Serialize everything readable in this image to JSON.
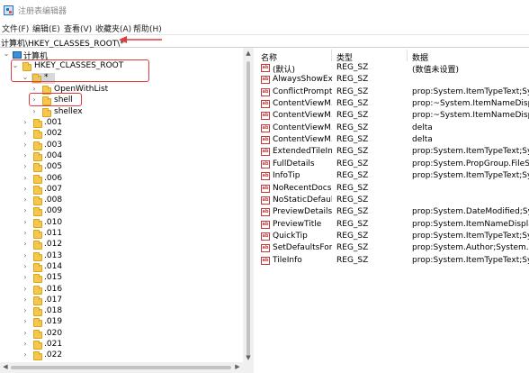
{
  "window": {
    "title": "注册表编辑器"
  },
  "menu": [
    "文件(F)",
    "编辑(E)",
    "查看(V)",
    "收藏夹(A)",
    "帮助(H)"
  ],
  "address": "计算机\\HKEY_CLASSES_ROOT\\*",
  "tree": {
    "root": "计算机",
    "hive": "HKEY_CLASSES_ROOT",
    "selected": "*",
    "children": [
      "OpenWithList",
      "shell",
      "shellex"
    ],
    "siblings": [
      ".001",
      ".002",
      ".003",
      ".004",
      ".005",
      ".006",
      ".007",
      ".008",
      ".009",
      ".010",
      ".011",
      ".012",
      ".013",
      ".014",
      ".015",
      ".016",
      ".017",
      ".018",
      ".019",
      ".020",
      ".021",
      ".022"
    ]
  },
  "values": {
    "columns": [
      "名称",
      "类型",
      "数据"
    ],
    "rows": [
      {
        "name": "(默认)",
        "type": "REG_SZ",
        "data": "(数值未设置)"
      },
      {
        "name": "AlwaysShowExt",
        "type": "REG_SZ",
        "data": ""
      },
      {
        "name": "ConflictPrompt",
        "type": "REG_SZ",
        "data": "prop:System.ItemTypeText;Syste"
      },
      {
        "name": "ContentViewM...",
        "type": "REG_SZ",
        "data": "prop:~System.ItemNameDisplay"
      },
      {
        "name": "ContentViewM...",
        "type": "REG_SZ",
        "data": "prop:~System.ItemNameDisplay"
      },
      {
        "name": "ContentViewM...",
        "type": "REG_SZ",
        "data": "delta"
      },
      {
        "name": "ContentViewM...",
        "type": "REG_SZ",
        "data": "delta"
      },
      {
        "name": "ExtendedTileIn...",
        "type": "REG_SZ",
        "data": "prop:System.ItemTypeText;Syste"
      },
      {
        "name": "FullDetails",
        "type": "REG_SZ",
        "data": "prop:System.PropGroup.FileSyst"
      },
      {
        "name": "InfoTip",
        "type": "REG_SZ",
        "data": "prop:System.ItemTypeText;Syste"
      },
      {
        "name": "NoRecentDocs",
        "type": "REG_SZ",
        "data": ""
      },
      {
        "name": "NoStaticDefaul...",
        "type": "REG_SZ",
        "data": ""
      },
      {
        "name": "PreviewDetails",
        "type": "REG_SZ",
        "data": "prop:System.DateModified;Syste"
      },
      {
        "name": "PreviewTitle",
        "type": "REG_SZ",
        "data": "prop:System.ItemNameDisplay;Sy"
      },
      {
        "name": "QuickTip",
        "type": "REG_SZ",
        "data": "prop:System.ItemTypeText;Syste"
      },
      {
        "name": "SetDefaultsFor",
        "type": "REG_SZ",
        "data": "prop:System.Author;System.Doc"
      },
      {
        "name": "TileInfo",
        "type": "REG_SZ",
        "data": "prop:System.ItemTypeText;Syste"
      }
    ]
  },
  "icons": {
    "string_value": "ab-icon"
  },
  "colors": {
    "annotation": "#e23b3b",
    "folder": "#f5c74a",
    "selection": "#d8d8d8"
  }
}
